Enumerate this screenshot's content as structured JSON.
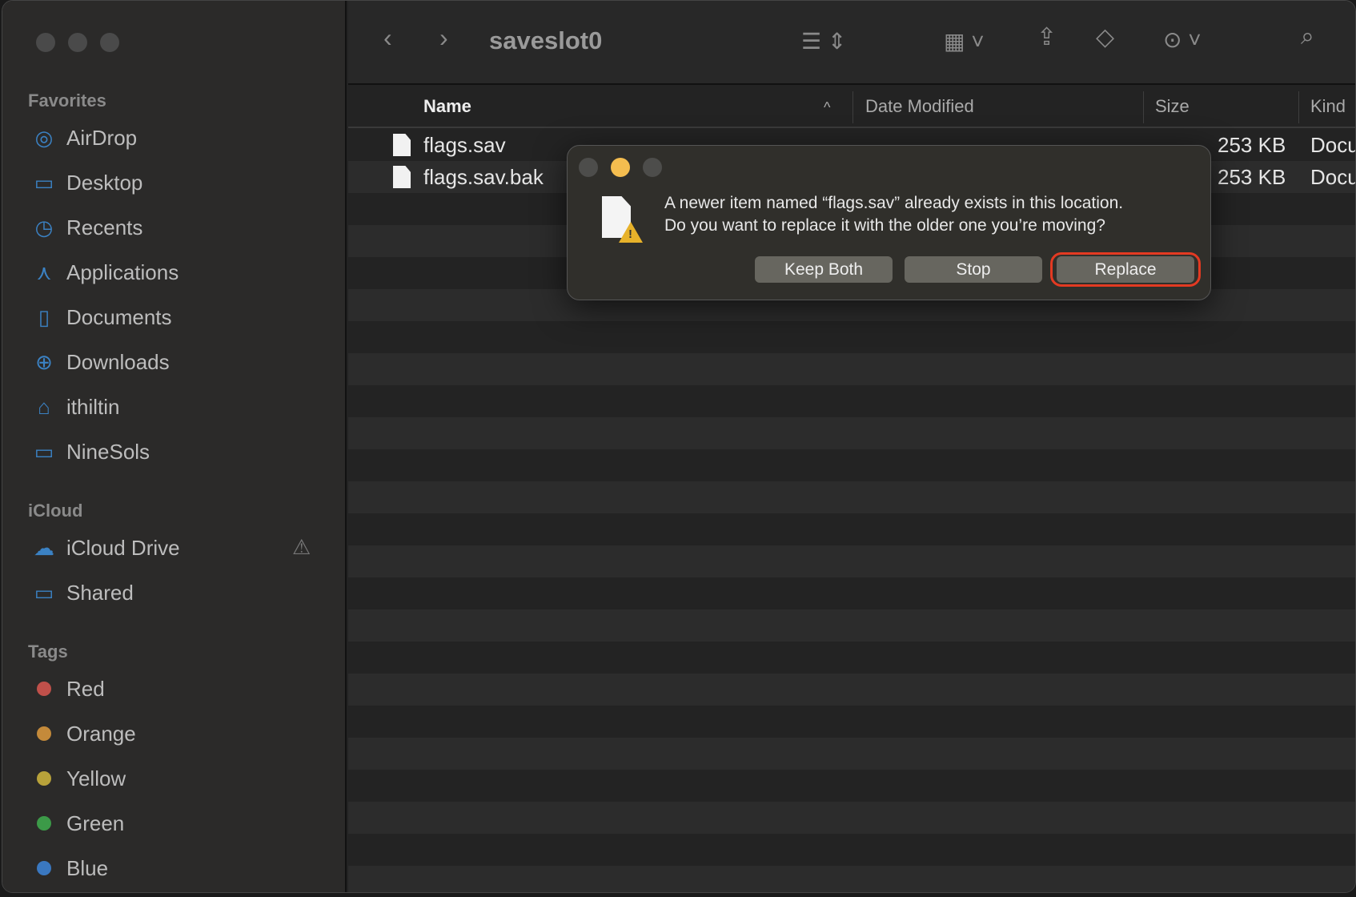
{
  "window": {
    "title": "saveslot0"
  },
  "sidebar": {
    "favorites_label": "Favorites",
    "favorites": [
      {
        "label": "AirDrop",
        "icon": "airdrop-icon"
      },
      {
        "label": "Desktop",
        "icon": "desktop-icon"
      },
      {
        "label": "Recents",
        "icon": "clock-icon"
      },
      {
        "label": "Applications",
        "icon": "applications-icon"
      },
      {
        "label": "Documents",
        "icon": "document-icon"
      },
      {
        "label": "Downloads",
        "icon": "download-icon"
      },
      {
        "label": "ithiltin",
        "icon": "home-icon"
      },
      {
        "label": "NineSols",
        "icon": "folder-icon"
      }
    ],
    "icloud_label": "iCloud",
    "icloud": [
      {
        "label": "iCloud Drive",
        "icon": "cloud-icon"
      },
      {
        "label": "Shared",
        "icon": "shared-folder-icon"
      }
    ],
    "tags_label": "Tags",
    "tags": [
      {
        "label": "Red",
        "color": "#c0504a"
      },
      {
        "label": "Orange",
        "color": "#c48a3a"
      },
      {
        "label": "Yellow",
        "color": "#b8a23a"
      },
      {
        "label": "Green",
        "color": "#3c9a48"
      },
      {
        "label": "Blue",
        "color": "#3a78c0"
      }
    ]
  },
  "columns": {
    "name": "Name",
    "date": "Date Modified",
    "size": "Size",
    "kind": "Kind"
  },
  "files": [
    {
      "name": "flags.sav",
      "size": "253 KB",
      "kind": "Docu"
    },
    {
      "name": "flags.sav.bak",
      "size": "253 KB",
      "kind": "Docu"
    }
  ],
  "dialog": {
    "line1": "A newer item named “flags.sav” already exists in this location.",
    "line2": "Do you want to replace it with the older one you’re moving?",
    "keep_both": "Keep Both",
    "stop": "Stop",
    "replace": "Replace"
  }
}
